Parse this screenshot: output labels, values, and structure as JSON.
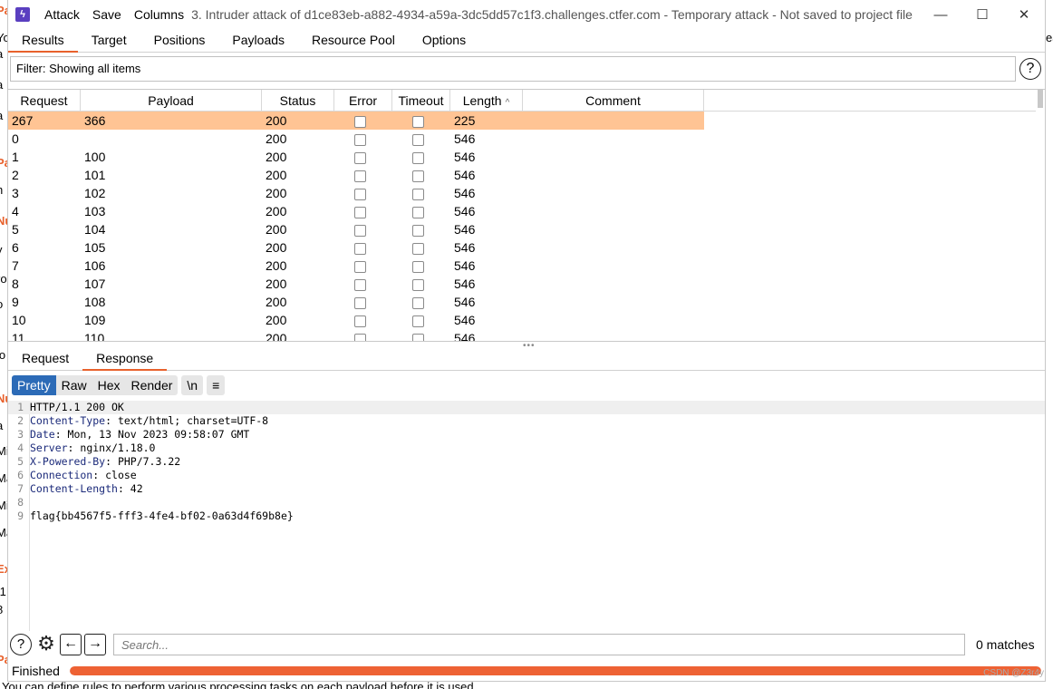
{
  "window": {
    "menu": [
      "Attack",
      "Save",
      "Columns"
    ],
    "title": "3. Intruder attack of d1ce83eb-a882-4934-a59a-3dc5dd57c1f3.challenges.ctfer.com - Temporary attack - Not saved to project file",
    "controls": {
      "minimize": "—",
      "maximize": "☐",
      "close": "✕"
    }
  },
  "tabs": [
    "Results",
    "Target",
    "Positions",
    "Payloads",
    "Resource Pool",
    "Options"
  ],
  "filter": {
    "text": "Filter: Showing all items",
    "help": "?"
  },
  "table": {
    "columns": [
      "Request",
      "Payload",
      "Status",
      "Error",
      "Timeout",
      "Length",
      "Comment"
    ],
    "sort_indicator": "^",
    "rows": [
      {
        "request": "267",
        "payload": "366",
        "status": "200",
        "length": "225"
      },
      {
        "request": "0",
        "payload": "",
        "status": "200",
        "length": "546"
      },
      {
        "request": "1",
        "payload": "100",
        "status": "200",
        "length": "546"
      },
      {
        "request": "2",
        "payload": "101",
        "status": "200",
        "length": "546"
      },
      {
        "request": "3",
        "payload": "102",
        "status": "200",
        "length": "546"
      },
      {
        "request": "4",
        "payload": "103",
        "status": "200",
        "length": "546"
      },
      {
        "request": "5",
        "payload": "104",
        "status": "200",
        "length": "546"
      },
      {
        "request": "6",
        "payload": "105",
        "status": "200",
        "length": "546"
      },
      {
        "request": "7",
        "payload": "106",
        "status": "200",
        "length": "546"
      },
      {
        "request": "8",
        "payload": "107",
        "status": "200",
        "length": "546"
      },
      {
        "request": "9",
        "payload": "108",
        "status": "200",
        "length": "546"
      },
      {
        "request": "10",
        "payload": "109",
        "status": "200",
        "length": "546"
      },
      {
        "request": "11",
        "payload": "110",
        "status": "200",
        "length": "546"
      }
    ]
  },
  "subtabs": [
    "Request",
    "Response"
  ],
  "view_buttons": [
    "Pretty",
    "Raw",
    "Hex",
    "Render"
  ],
  "newline_button": "\\n",
  "menu_button": "≡",
  "response": {
    "lines": [
      {
        "n": "1",
        "key": "",
        "text": "HTTP/1.1 200 OK"
      },
      {
        "n": "2",
        "key": "Content-Type",
        "text": ": text/html; charset=UTF-8"
      },
      {
        "n": "3",
        "key": "Date",
        "text": ": Mon, 13 Nov 2023 09:58:07 GMT"
      },
      {
        "n": "4",
        "key": "Server",
        "text": ": nginx/1.18.0"
      },
      {
        "n": "5",
        "key": "X-Powered-By",
        "text": ": PHP/7.3.22"
      },
      {
        "n": "6",
        "key": "Connection",
        "text": ": close"
      },
      {
        "n": "7",
        "key": "Content-Length",
        "text": ": 42"
      },
      {
        "n": "8",
        "key": "",
        "text": ""
      },
      {
        "n": "9",
        "key": "",
        "text": "flag{bb4567f5-fff3-4fe4-bf02-0a63d4f69b8e}"
      }
    ]
  },
  "search": {
    "placeholder": "Search...",
    "matches": "0 matches"
  },
  "status": {
    "text": "Finished",
    "progress": 1.0
  },
  "background": {
    "bottom_text": "You can define rules to perform various processing tasks on each payload before it is used.",
    "watermark": "CSDN @Z3r4y"
  },
  "colors": {
    "accent": "#e8612c",
    "selected_row": "#ffc494",
    "active_view": "#2c6bb7",
    "progress": "#ee6234"
  }
}
